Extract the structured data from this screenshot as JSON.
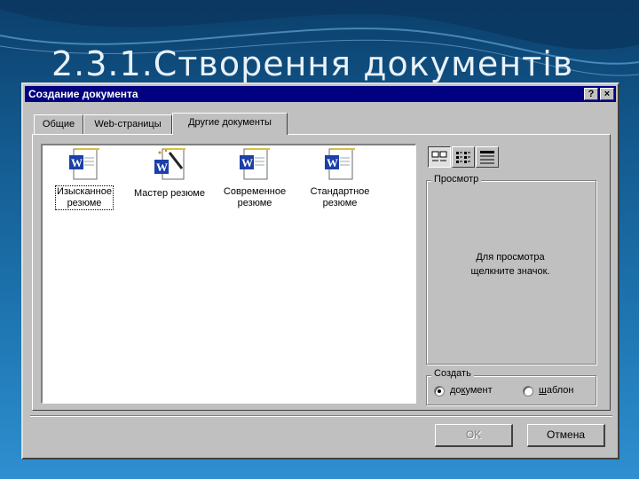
{
  "slide": {
    "title": "2.3.1.Створення документів"
  },
  "dialog": {
    "title": "Создание документа",
    "help_button": "?",
    "close_button": "×",
    "tabs": [
      {
        "label": "Общие",
        "active": false
      },
      {
        "label": "Web-страницы",
        "active": false
      },
      {
        "label": "Другие документы",
        "active": true
      }
    ],
    "templates": [
      {
        "line1": "Изысканное",
        "line2": "резюме",
        "icon": "word-document-icon",
        "selected": true
      },
      {
        "line1": "Мастер резюме",
        "line2": "",
        "icon": "word-wizard-icon",
        "selected": false
      },
      {
        "line1": "Современное",
        "line2": "резюме",
        "icon": "word-document-icon",
        "selected": false
      },
      {
        "line1": "Стандартное",
        "line2": "резюме",
        "icon": "word-document-icon",
        "selected": false
      }
    ],
    "view_buttons": [
      {
        "name": "large-icons-view",
        "pressed": true
      },
      {
        "name": "list-view",
        "pressed": false
      },
      {
        "name": "details-view",
        "pressed": false
      }
    ],
    "preview": {
      "legend": "Просмотр",
      "text_line1": "Для просмотра",
      "text_line2": "щелкните значок."
    },
    "create": {
      "legend": "Создать",
      "options": [
        {
          "pre": "до",
          "underlined": "к",
          "post": "умент",
          "checked": true
        },
        {
          "pre": "",
          "underlined": "ш",
          "post": "аблон",
          "checked": false
        }
      ]
    },
    "ok_label": "OK",
    "cancel_label": "Отмена"
  },
  "colors": {
    "titlebar": "#000080",
    "dialog_face": "#c0c0c0",
    "word_blue": "#1c3fa8",
    "slide_bg": "#1f78b4"
  }
}
